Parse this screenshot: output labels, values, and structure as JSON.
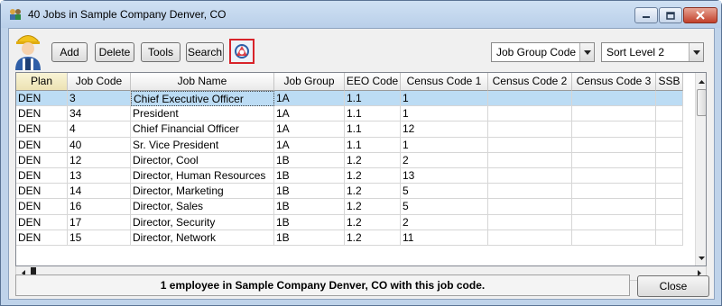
{
  "window": {
    "title": "40 Jobs in Sample Company Denver, CO"
  },
  "toolbar": {
    "add_label": "Add",
    "delete_label": "Delete",
    "tools_label": "Tools",
    "search_label": "Search",
    "bi_icon": "business-intelligence-icon",
    "group_combo_value": "Job Group Code",
    "sort_combo_value": "Sort Level 2"
  },
  "grid": {
    "columns": [
      "Plan",
      "Job Code",
      "Job Name",
      "Job Group",
      "EEO Code",
      "Census Code 1",
      "Census Code 2",
      "Census Code 3",
      "SSB"
    ],
    "rows": [
      [
        "DEN",
        "3",
        "Chief Executive Officer",
        "1A",
        "1.1",
        "1",
        "",
        "",
        ""
      ],
      [
        "DEN",
        "34",
        "President",
        "1A",
        "1.1",
        "1",
        "",
        "",
        ""
      ],
      [
        "DEN",
        "4",
        "Chief Financial Officer",
        "1A",
        "1.1",
        "12",
        "",
        "",
        ""
      ],
      [
        "DEN",
        "40",
        "Sr. Vice President",
        "1A",
        "1.1",
        "1",
        "",
        "",
        ""
      ],
      [
        "DEN",
        "12",
        "Director, Cool",
        "1B",
        "1.2",
        "2",
        "",
        "",
        ""
      ],
      [
        "DEN",
        "13",
        "Director, Human Resources",
        "1B",
        "1.2",
        "13",
        "",
        "",
        ""
      ],
      [
        "DEN",
        "14",
        "Director, Marketing",
        "1B",
        "1.2",
        "5",
        "",
        "",
        ""
      ],
      [
        "DEN",
        "16",
        "Director, Sales",
        "1B",
        "1.2",
        "5",
        "",
        "",
        ""
      ],
      [
        "DEN",
        "17",
        "Director, Security",
        "1B",
        "1.2",
        "2",
        "",
        "",
        ""
      ],
      [
        "DEN",
        "15",
        "Director, Network",
        "1B",
        "1.2",
        "11",
        "",
        "",
        ""
      ]
    ],
    "selected_row": 0
  },
  "status": {
    "message": "1 employee in Sample Company Denver, CO with this job code."
  },
  "footer": {
    "close_label": "Close"
  }
}
